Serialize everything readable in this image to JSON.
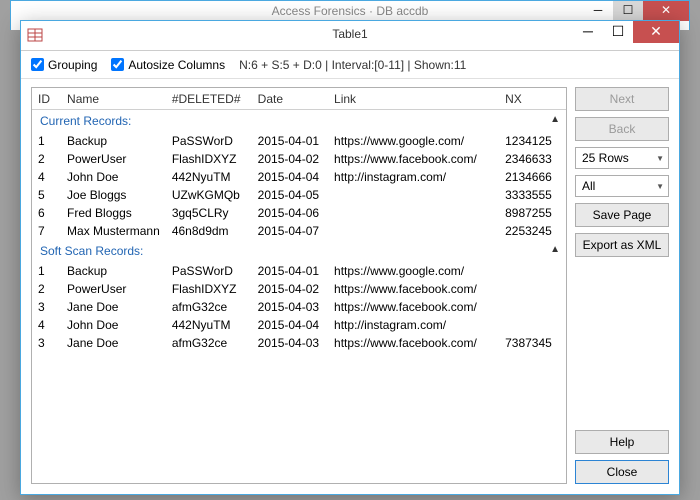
{
  "outer": {
    "title": "Access Forensics · DB accdb"
  },
  "dialog": {
    "title": "Table1"
  },
  "toolbar": {
    "grouping_label": "Grouping",
    "autosize_label": "Autosize Columns",
    "status": "N:6 + S:5 + D:0 | Interval:[0-11] | Shown:11"
  },
  "columns": {
    "id": "ID",
    "name": "Name",
    "deleted": "#DELETED#",
    "date": "Date",
    "link": "Link",
    "nx": "NX"
  },
  "groups": {
    "current": "Current Records:",
    "soft": "Soft Scan Records:"
  },
  "current_rows": [
    {
      "id": "1",
      "name": "Backup",
      "del": "PaSSWorD",
      "date": "2015-04-01",
      "link": "https://www.google.com/",
      "nx": "1234125"
    },
    {
      "id": "2",
      "name": "PowerUser",
      "del": "FlashIDXYZ",
      "date": "2015-04-02",
      "link": "https://www.facebook.com/",
      "nx": "2346633"
    },
    {
      "id": "4",
      "name": "John Doe",
      "del": "442NyuTM",
      "date": "2015-04-04",
      "link": "http://instagram.com/",
      "nx": "2134666"
    },
    {
      "id": "5",
      "name": "Joe Bloggs",
      "del": "UZwKGMQb",
      "date": "2015-04-05",
      "link": "",
      "nx": "3333555"
    },
    {
      "id": "6",
      "name": "Fred Bloggs",
      "del": "3gq5CLRy",
      "date": "2015-04-06",
      "link": "",
      "nx": "8987255"
    },
    {
      "id": "7",
      "name": "Max Mustermann",
      "del": "46n8d9dm",
      "date": "2015-04-07",
      "link": "",
      "nx": "2253245"
    }
  ],
  "soft_rows": [
    {
      "id": "1",
      "name": "Backup",
      "del": "PaSSWorD",
      "date": "2015-04-01",
      "link": "https://www.google.com/",
      "nx": ""
    },
    {
      "id": "2",
      "name": "PowerUser",
      "del": "FlashIDXYZ",
      "date": "2015-04-02",
      "link": "https://www.facebook.com/",
      "nx": ""
    },
    {
      "id": "3",
      "name": "Jane Doe",
      "del": "afmG32ce",
      "date": "2015-04-03",
      "link": "https://www.facebook.com/",
      "nx": ""
    },
    {
      "id": "4",
      "name": "John Doe",
      "del": "442NyuTM",
      "date": "2015-04-04",
      "link": "http://instagram.com/",
      "nx": ""
    },
    {
      "id": "3",
      "name": "Jane Doe",
      "del": "afmG32ce",
      "date": "2015-04-03",
      "link": "https://www.facebook.com/",
      "nx": "7387345"
    }
  ],
  "side": {
    "next": "Next",
    "back": "Back",
    "rows_select": "25 Rows",
    "all_select": "All",
    "save_page": "Save Page",
    "export": "Export as XML",
    "help": "Help",
    "close": "Close"
  }
}
